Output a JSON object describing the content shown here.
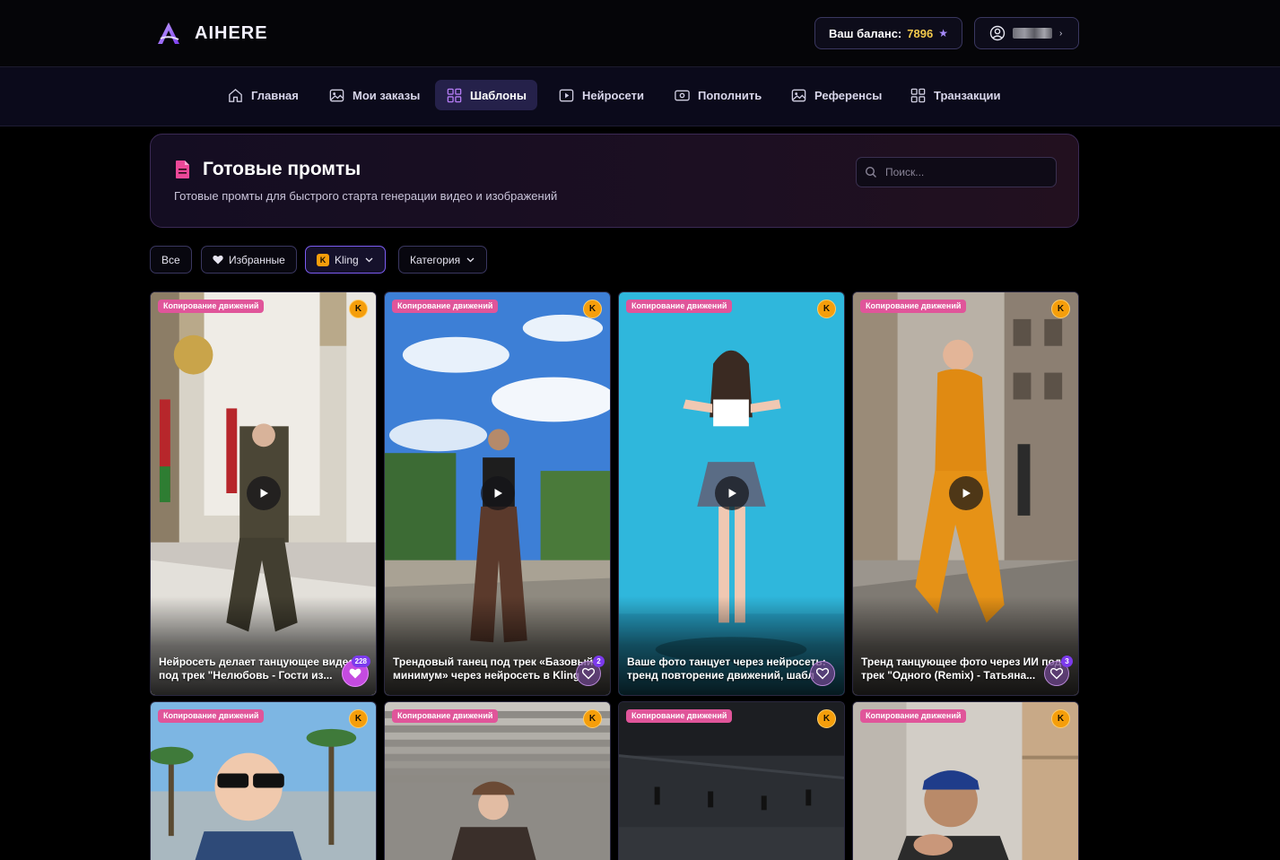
{
  "header": {
    "logo_text": "AIHERE",
    "balance_label": "Ваш баланс:",
    "balance_value": "7896",
    "balance_star": "★",
    "user_chevron": "›"
  },
  "nav": {
    "items": [
      {
        "label": "Главная",
        "icon": "home-icon"
      },
      {
        "label": "Мои заказы",
        "icon": "image-icon"
      },
      {
        "label": "Шаблоны",
        "icon": "grid-icon",
        "active": true
      },
      {
        "label": "Нейросети",
        "icon": "video-icon"
      },
      {
        "label": "Пополнить",
        "icon": "wallet-icon"
      },
      {
        "label": "Референсы",
        "icon": "image-icon"
      },
      {
        "label": "Транзакции",
        "icon": "grid-icon"
      }
    ]
  },
  "hero": {
    "title": "Готовые промты",
    "subtitle": "Готовые промты для быстрого старта генерации видео и изображений",
    "search_placeholder": "Поиск..."
  },
  "filters": {
    "all": "Все",
    "favorites": "Избранные",
    "model": "Kling",
    "model_badge": "K",
    "category": "Категория"
  },
  "cards": [
    {
      "tag": "Копирование движений",
      "badge": "K",
      "line1": "Нейросеть делает танцующее видео",
      "line2": "под трек \"Нелюбовь - Гости из...",
      "count": "228",
      "liked": true
    },
    {
      "tag": "Копирование движений",
      "badge": "K",
      "line1": "Трендовый танец под трек «Базовый",
      "line2": "минимум» через нейросеть в Kling",
      "count": "2",
      "liked": false
    },
    {
      "tag": "Копирование движений",
      "badge": "K",
      "line1": "Ваше фото танцует через нейросеть:",
      "line2": "тренд повторение движений, шабл",
      "count": "",
      "liked": false
    },
    {
      "tag": "Копирование движений",
      "badge": "K",
      "line1": "Тренд танцующее фото через ИИ под",
      "line2": "трек \"Одного (Remix) - Татьяна...",
      "count": "3",
      "liked": false
    },
    {
      "tag": "Копирование движений",
      "badge": "K"
    },
    {
      "tag": "Копирование движений",
      "badge": "K"
    },
    {
      "tag": "Копирование движений",
      "badge": "K"
    },
    {
      "tag": "Копирование движений",
      "badge": "K"
    }
  ]
}
